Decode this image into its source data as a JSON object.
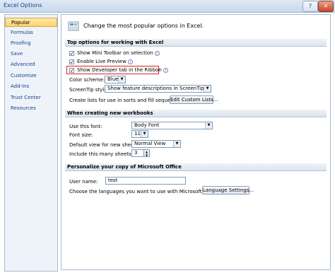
{
  "window": {
    "title": "Excel Options",
    "help_label": "?",
    "close_label": "✕"
  },
  "sidebar": {
    "items": [
      {
        "label": "Popular",
        "selected": true
      },
      {
        "label": "Formulas"
      },
      {
        "label": "Proofing"
      },
      {
        "label": "Save"
      },
      {
        "label": "Advanced"
      },
      {
        "label": "Customize"
      },
      {
        "label": "Add-Ins"
      },
      {
        "label": "Trust Center"
      },
      {
        "label": "Resources"
      }
    ]
  },
  "header": {
    "text": "Change the most popular options in Excel."
  },
  "top_options": {
    "title": "Top options for working with Excel",
    "mini_toolbar": {
      "label": "Show Mini Toolbar on selection",
      "checked": true
    },
    "live_preview": {
      "label": "Enable Live Preview",
      "checked": true
    },
    "developer_tab": {
      "label": "Show Developer tab in the Ribbon",
      "checked": true
    },
    "color_scheme": {
      "label": "Color scheme:",
      "value": "Blue"
    },
    "screentip": {
      "label": "ScreenTip style:",
      "value": "Show feature descriptions in ScreenTips"
    },
    "custom_lists": {
      "label": "Create lists for use in sorts and fill sequences:",
      "button": "Edit Custom Lists..."
    }
  },
  "new_workbooks": {
    "title": "When creating new workbooks",
    "font": {
      "label": "Use this font:",
      "value": "Body Font"
    },
    "font_size": {
      "label": "Font size:",
      "value": "11"
    },
    "default_view": {
      "label": "Default view for new sheets:",
      "value": "Normal View"
    },
    "sheets": {
      "label": "Include this many sheets:",
      "value": "3"
    }
  },
  "personalize": {
    "title": "Personalize your copy of Microsoft Office",
    "user_name": {
      "label": "User name:",
      "value": "test"
    },
    "languages": {
      "label": "Choose the languages you want to use with Microsoft Office:",
      "button": "Language Settings..."
    }
  },
  "colors": {
    "highlight_border": "#e02020",
    "selected_item": "#ffd26a"
  }
}
